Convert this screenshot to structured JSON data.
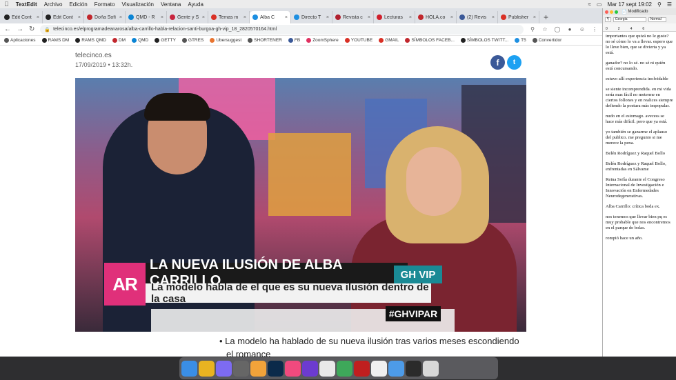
{
  "menubar": {
    "app_name": "TextEdit",
    "items": [
      "Archivo",
      "Edición",
      "Formato",
      "Visualización",
      "Ventana",
      "Ayuda"
    ],
    "clock": "Mar 17 sept  19:02"
  },
  "tabs": [
    {
      "label": "Edit Cont",
      "color": "#222222"
    },
    {
      "label": "Edit Cont",
      "color": "#222222"
    },
    {
      "label": "Doña Sofí",
      "color": "#c1272d"
    },
    {
      "label": "QMD - R",
      "color": "#0a84d4"
    },
    {
      "label": "Gente y S",
      "color": "#c8253e"
    },
    {
      "label": "Temas m",
      "color": "#d93025"
    },
    {
      "label": "Alba C",
      "color": "#1d8fe1",
      "active": true
    },
    {
      "label": "Directo T",
      "color": "#1d8fe1"
    },
    {
      "label": "Revista c",
      "color": "#b0202e"
    },
    {
      "label": "Lecturas",
      "color": "#d01f2c"
    },
    {
      "label": "HOLA.co",
      "color": "#c1272d"
    },
    {
      "label": "(2) Revis",
      "color": "#3b5998"
    },
    {
      "label": "Publisher",
      "color": "#d93025"
    }
  ],
  "address_bar": {
    "url": "telecinco.es/elprogramadeanarosa/alba-carrillo-habla-relacion-santi-burgoa-gh-vip_18_2820570164.html"
  },
  "bookmarks": [
    {
      "label": "Aplicaciones",
      "color": "#555555"
    },
    {
      "label": "RAMS DM",
      "color": "#222222"
    },
    {
      "label": "RAMS QMD",
      "color": "#222222"
    },
    {
      "label": "DM",
      "color": "#c1272d"
    },
    {
      "label": "QMD",
      "color": "#0a84d4"
    },
    {
      "label": "GETTY",
      "color": "#222222"
    },
    {
      "label": "GTRES",
      "color": "#555555"
    },
    {
      "label": "Ubersuggest",
      "color": "#e8742f"
    },
    {
      "label": "SHORTENER",
      "color": "#555555"
    },
    {
      "label": "FB",
      "color": "#3b5998"
    },
    {
      "label": "ZoomSphere",
      "color": "#e03060"
    },
    {
      "label": "YOUTUBE",
      "color": "#d93025"
    },
    {
      "label": "GMAIL",
      "color": "#d93025"
    },
    {
      "label": "SÍMBOLOS FACEB...",
      "color": "#c1272d"
    },
    {
      "label": "SÍMBOLOS TWITT...",
      "color": "#222222"
    },
    {
      "label": "T5",
      "color": "#1d8fe1"
    },
    {
      "label": "Convertidor",
      "color": "#555555"
    }
  ],
  "article": {
    "source": "telecinco.es",
    "date": "17/09/2019  •  13:32h.",
    "share_facebook": "f",
    "share_twitter": "t",
    "video": {
      "program_logo": "AR",
      "lower_third_title": "LA NUEVA ILUSIÓN DE ALBA CARRILLO",
      "lower_third_tag": "GH VIP",
      "lower_third_subtitle": "La modelo habla de el que es su nueva ilusión dentro de la casa",
      "hashtag": "#GHVIPAR"
    },
    "bullet_line1": "La modelo ha hablado de su nueva ilusión tras varios meses escondiendo",
    "bullet_line2": "el romance"
  },
  "textedit": {
    "title": "Modificado",
    "font": "Georgia",
    "style": "Normal",
    "paragraphs": [
      "importantes que quizá no le guste? no sé cómo lo va a llevar. espero que lo lleve bien, que se divierta y ya está.",
      "ganador? no lo sé. no sé ni quién está concursando.",
      "estuvo allí experiencia inolvidable",
      "se siente incomprendida. en mi vida sería mas fácil no meterme en ciertos follones y en realices siempre defiendo la postura más impopular.",
      "nudo en el estomago. avecess se hace más difícil. pero que ya está.",
      "yo también se ganarme el aplauso del publico. me pregunto si me merece la pena.",
      "Belén Rodríguez y Raquel Bollo",
      "Belén Rodríguez y Raquel Bollo, enfrentadas en Sálvame",
      "Reina Sofía durante el Congreso Internacional de Investigación e Innovación en Enfermedades Neurodegenerativas.",
      "Alba Carrillo: crítica boda ex.",
      "nos tenemos que llevar bien pq es muy probable que nos encontremos en el parque de bolas.",
      "rompió hace un año."
    ]
  },
  "dock": [
    {
      "name": "finder",
      "color": "#3a8ee6"
    },
    {
      "name": "chrome",
      "color": "#e9b321"
    },
    {
      "name": "siri",
      "color": "#7d6bf2"
    },
    {
      "name": "screenshot",
      "color": "#666666"
    },
    {
      "name": "photos",
      "color": "#f2a33a"
    },
    {
      "name": "photoshop",
      "color": "#0b2a4a"
    },
    {
      "name": "itunes",
      "color": "#f04a7e"
    },
    {
      "name": "imovie",
      "color": "#6c3bd0"
    },
    {
      "name": "notes",
      "color": "#e9e9e9"
    },
    {
      "name": "whatsapp",
      "color": "#3ea85a"
    },
    {
      "name": "bitdefender",
      "color": "#c01f1f"
    },
    {
      "name": "document",
      "color": "#f0f0f0"
    },
    {
      "name": "folder",
      "color": "#4d9be8"
    },
    {
      "name": "display",
      "color": "#2b2b2b"
    },
    {
      "name": "trash",
      "color": "#d8d8d8"
    }
  ]
}
